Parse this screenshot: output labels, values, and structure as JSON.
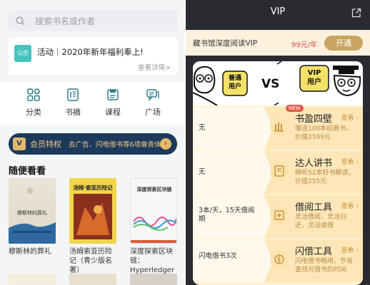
{
  "left": {
    "search": {
      "placeholder": "搜索书名或作者"
    },
    "notice": {
      "badge": "公告",
      "text": "活动｜2020年新年福利奉上!",
      "more": "查看详情>"
    },
    "categories": [
      {
        "label": "分类",
        "icon": "grid-icon"
      },
      {
        "label": "书摘",
        "icon": "book-excerpt-icon"
      },
      {
        "label": "课程",
        "icon": "course-icon"
      },
      {
        "label": "广场",
        "icon": "chat-square-icon"
      }
    ],
    "vip_banner": {
      "mark": "V",
      "label": "会员特权",
      "text": "去广告、闪电借书等6项尊贵体验",
      "arrow": "›"
    },
    "section_title": "随便看看",
    "books": [
      {
        "title": "穆斯林的葬礼",
        "cover_title": "穆斯林的葬礼"
      },
      {
        "title": "汤姆索亚历险记（青少版名著）",
        "cover_title": "汤姆·索亚历险记"
      },
      {
        "title": "深度探索区块链：Hyperledger",
        "cover_title": "深度探索区块链"
      }
    ],
    "colors": {
      "accent": "#45c4bd",
      "vip_bg": "#1d3a5c",
      "vip_gold": "#e6b86b"
    }
  },
  "right": {
    "title": "VIP",
    "vip_card": {
      "name": "藏书馆深度阅读VIP",
      "price": "99元/年",
      "button": "开通"
    },
    "comic": {
      "left_bubble": "普通\n用户",
      "vs": "VS",
      "right_bubble": "VIP\n用户"
    },
    "features": [
      {
        "left_text": "无",
        "name": "书盈四壁",
        "look": "查看 ›",
        "desc": "赠送100本经典书，价值2599元",
        "new": "NEW",
        "icon": "bookshelf-icon"
      },
      {
        "left_text": "无",
        "name": "达人讲书",
        "look": "查看 ›",
        "desc": "畅听52本好书解读，价值255元",
        "new": "",
        "icon": "audio-book-icon"
      },
      {
        "left_text": "3本/天，15天借阅期",
        "name": "借阅工具",
        "look": "查看 ›",
        "desc": "灵活借阅，灵活归还，灵活续借",
        "new": "",
        "icon": "borrow-tool-icon"
      },
      {
        "left_text": "闪电借书3次",
        "name": "闪借工具",
        "look": "查看 ›",
        "desc": "闪电借书畅用，节省查找可借书的时间",
        "new": "",
        "icon": "lightning-icon"
      }
    ],
    "colors": {
      "gold": "#c9a562",
      "panel": "#fff3d6",
      "price": "#d9534f"
    }
  }
}
